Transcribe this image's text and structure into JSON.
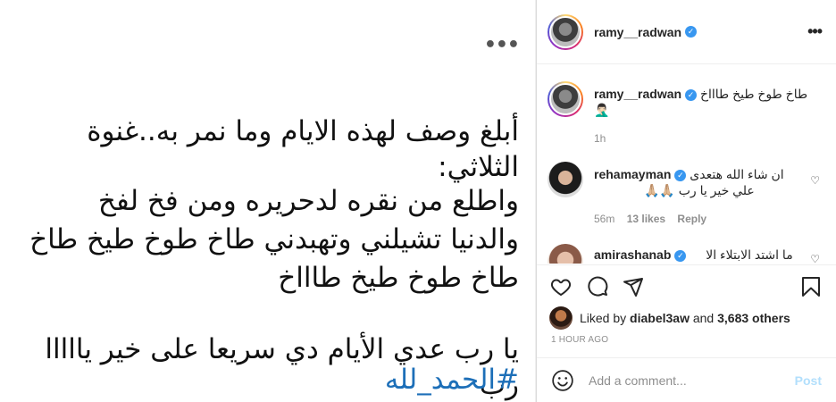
{
  "media": {
    "lines": [
      "أبلغ وصف لهذه الايام وما نمر به..غنوة الثلاثي:",
      "واطلع من نقره لدحريره ومن فخ لفخ",
      "والدنيا تشيلني وتهبدني طاخ طوخ طيخ طاخ",
      "طاخ طوخ طيخ طاااخ",
      "يا رب عدي الأيام دي سريعا على خير يااااا رب",
      "#الحمد_لله"
    ],
    "more_icon": "more-horizontal-icon"
  },
  "header": {
    "username": "ramy__radwan",
    "verified_icon": "verified-badge-icon",
    "more_icon": "more-horizontal-icon"
  },
  "caption": {
    "username": "ramy__radwan",
    "text": "طاخ طوخ طيخ طاااخ",
    "emoji": "🤦🏻‍♂️",
    "age": "1h"
  },
  "comments": [
    {
      "username": "rehamayman",
      "text": "ان شاء الله هتعدى",
      "text2": "علي خير يا رب 🙏🏼🙏🏼",
      "age": "56m",
      "likes": "13 likes",
      "reply": "Reply"
    },
    {
      "username": "amirashanab",
      "text": "ما اشتد الابتلاء الا"
    }
  ],
  "actions": {
    "like_icon": "heart-icon",
    "comment_icon": "comment-icon",
    "share_icon": "paper-plane-icon",
    "save_icon": "bookmark-icon"
  },
  "likes": {
    "prefix": "Liked by ",
    "user": "diabel3aw",
    "middle": " and ",
    "others": "3,683 others"
  },
  "timestamp": "1 HOUR AGO",
  "add_comment": {
    "placeholder": "Add a comment...",
    "post_label": "Post",
    "emoji_icon": "smiley-icon"
  },
  "colors": {
    "accent": "#3897f0",
    "post_disabled": "#b2dffc",
    "hashtag": "#1d6fb8"
  }
}
